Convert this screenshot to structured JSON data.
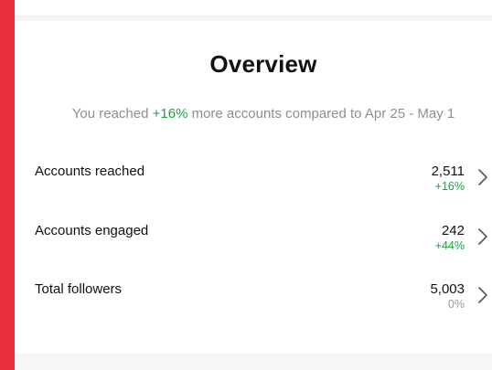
{
  "overview": {
    "title": "Overview",
    "summary_prefix": "You reached ",
    "summary_change": "+16%",
    "summary_suffix": " more accounts compared to Apr 25 - May 1"
  },
  "metrics": [
    {
      "label": "Accounts reached",
      "value": "2,511",
      "change": "+16%",
      "change_color": "#1f9d45"
    },
    {
      "label": "Accounts engaged",
      "value": "242",
      "change": "+44%",
      "change_color": "#1f9d45"
    },
    {
      "label": "Total followers",
      "value": "5,003",
      "change": "0%",
      "change_color": "#9a9a9a"
    }
  ],
  "colors": {
    "background_accent": "#e8303f",
    "positive": "#1f9d45",
    "neutral": "#9a9a9a"
  },
  "icons": {
    "row_arrow": "chevron-right-icon"
  }
}
